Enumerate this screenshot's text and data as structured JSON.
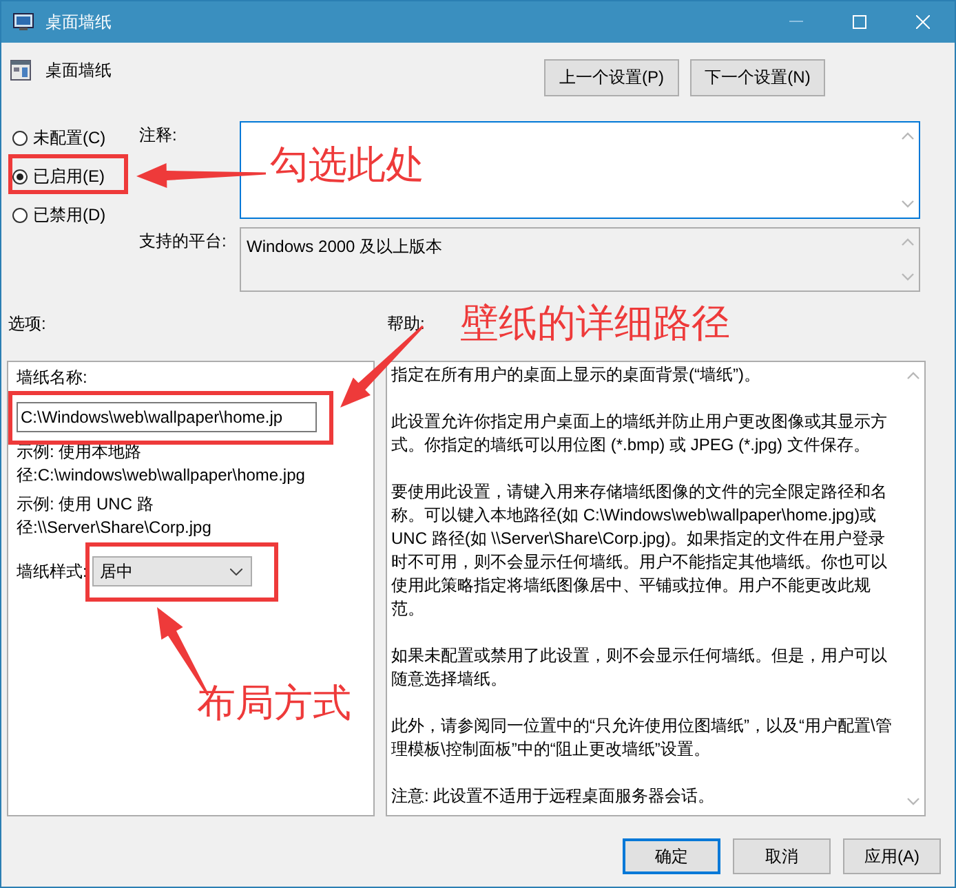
{
  "window": {
    "title": "桌面墙纸"
  },
  "header": {
    "title": "桌面墙纸",
    "buttons": [
      "上一个设置(P)",
      "下一个设置(N)"
    ]
  },
  "state_options": [
    {
      "label": "未配置(C)",
      "selected": false
    },
    {
      "label": "已启用(E)",
      "selected": true
    },
    {
      "label": "已禁用(D)",
      "selected": false
    }
  ],
  "comment": {
    "label": "注释:"
  },
  "platform": {
    "label": "支持的平台:",
    "value": "Windows 2000 及以上版本"
  },
  "options": {
    "heading": "选项:",
    "items": [
      {
        "kind": "label",
        "text": "墙纸名称:"
      },
      {
        "kind": "input",
        "value": "C:\\Windows\\web\\wallpaper\\home.jp"
      },
      {
        "kind": "note",
        "text": "示例: 使用本地路径:C:\\windows\\web\\wallpaper\\home.jpg"
      },
      {
        "kind": "note",
        "text": "示例: 使用 UNC 路径:\\\\Server\\Share\\Corp.jpg"
      },
      {
        "kind": "combo",
        "label": "墙纸样式:",
        "value": "居中"
      }
    ]
  },
  "help": {
    "heading": "帮助:",
    "paragraphs": [
      "指定在所有用户的桌面上显示的桌面背景(“墙纸”)。",
      "此设置允许你指定用户桌面上的墙纸并防止用户更改图像或其显示方式。你指定的墙纸可以用位图 (*.bmp) 或 JPEG (*.jpg) 文件保存。",
      "要使用此设置，请键入用来存储墙纸图像的文件的完全限定路径和名称。可以键入本地路径(如 C:\\Windows\\web\\wallpaper\\home.jpg)或 UNC 路径(如 \\\\Server\\Share\\Corp.jpg)。如果指定的文件在用户登录时不可用，则不会显示任何墙纸。用户不能指定其他墙纸。你也可以使用此策略指定将墙纸图像居中、平铺或拉伸。用户不能更改此规范。",
      "如果未配置或禁用了此设置，则不会显示任何墙纸。但是，用户可以随意选择墙纸。",
      "此外，请参阅同一位置中的“只允许使用位图墙纸”，以及“用户配置\\管理模板\\控制面板”中的“阻止更改墙纸”设置。",
      "注意: 此设置不适用于远程桌面服务器会话。"
    ]
  },
  "footer_buttons": [
    {
      "label": "确定",
      "default": true
    },
    {
      "label": "取消",
      "default": false
    },
    {
      "label": "应用(A)",
      "default": false
    }
  ],
  "callouts": [
    {
      "text": "勾选此处"
    },
    {
      "text": "壁纸的详细路径"
    },
    {
      "text": "布局方式"
    }
  ]
}
